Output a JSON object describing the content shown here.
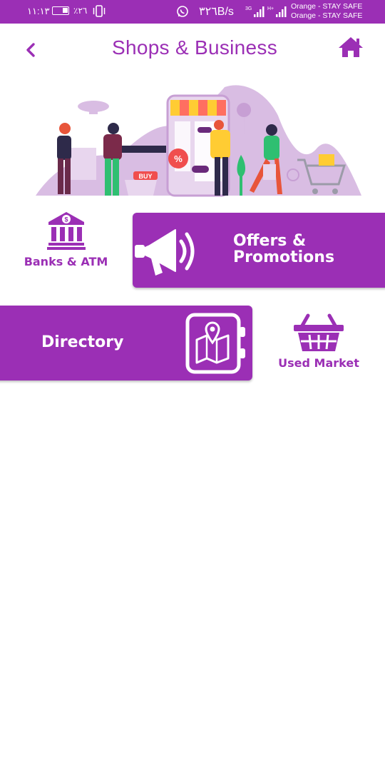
{
  "status_bar": {
    "time": "١١:١٣",
    "battery_percent": "٪٢٦",
    "network_speed": "٣٢٦B/s",
    "carrier_line1": "Orange - STAY SAFE",
    "carrier_line2": "Orange - STAY SAFE",
    "icons": [
      "battery-icon",
      "vibrate-icon",
      "whatsapp-icon",
      "signal-icon",
      "signal-icon"
    ]
  },
  "header": {
    "title": "Shops & Business",
    "back_icon": "chevron-left-icon",
    "home_icon": "home-icon"
  },
  "hero": {
    "badge_text": "BUY",
    "discount_symbol": "%"
  },
  "menu": {
    "banks_label": "Banks & ATM",
    "offers_line1": "Offers &",
    "offers_line2": "Promotions",
    "directory_label": "Directory",
    "used_market_label": "Used Market"
  },
  "colors": {
    "primary": "#9b2fb5",
    "light_purple": "#d9bde3",
    "background": "#ffffff"
  }
}
